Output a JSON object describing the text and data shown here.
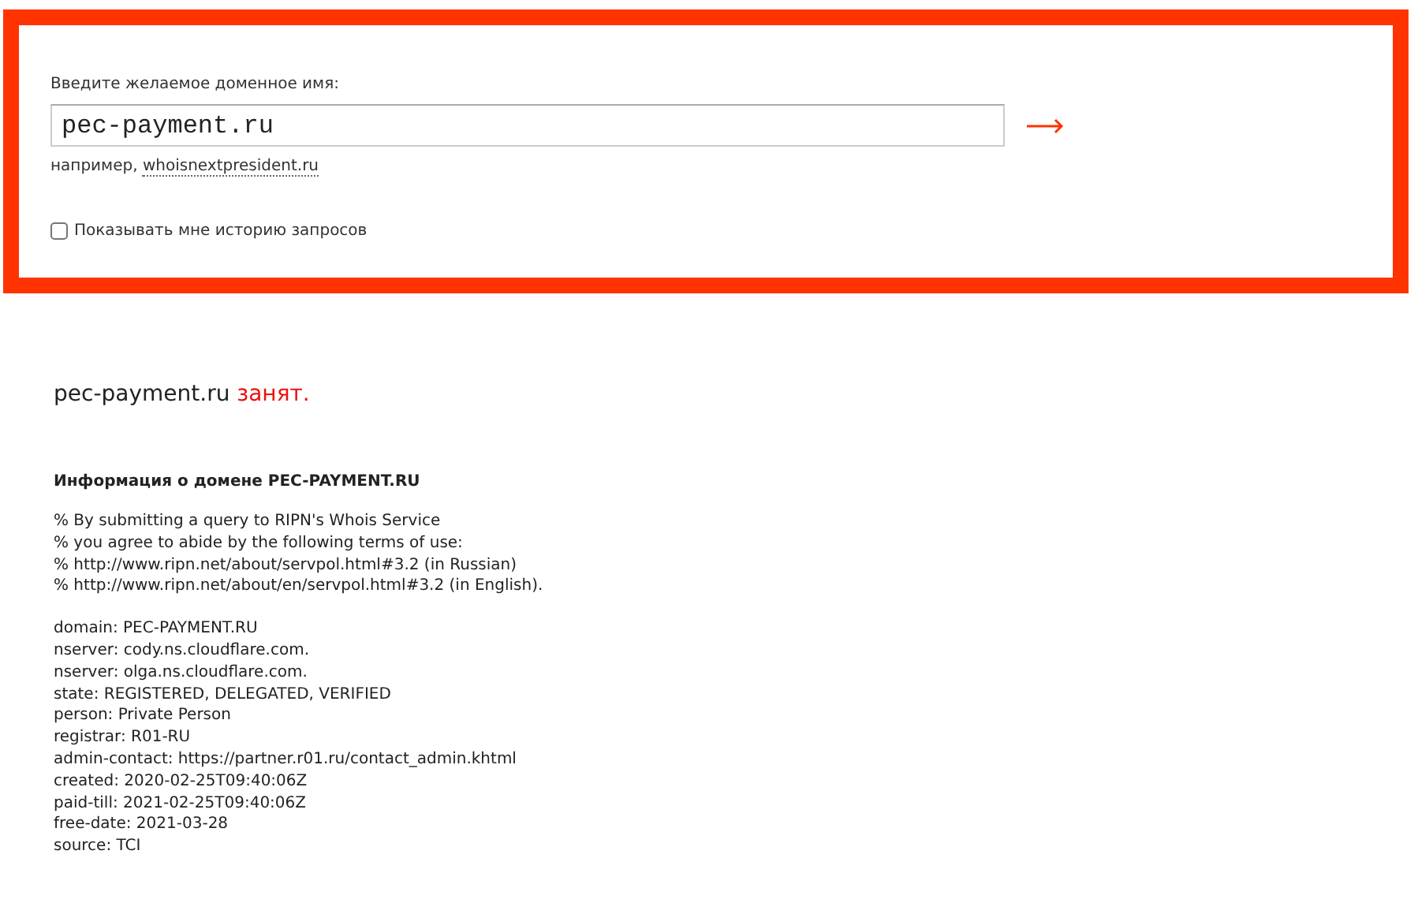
{
  "search": {
    "label": "Введите желаемое доменное имя:",
    "value": "pec-payment.ru",
    "example_prefix": "например,",
    "example_link": "whoisnextpresident.ru",
    "history": {
      "label": "Показывать мне историю запросов",
      "checked": false
    }
  },
  "result": {
    "domain": "pec-payment.ru",
    "status": "занят.",
    "taken": true
  },
  "info": {
    "title": "Информация о домене PEC-PAYMENT.RU",
    "notice": [
      "% By submitting a query to RIPN's Whois Service",
      "% you agree to abide by the following terms of use:",
      "% http://www.ripn.net/about/servpol.html#3.2 (in Russian)",
      "% http://www.ripn.net/about/en/servpol.html#3.2 (in English)."
    ],
    "records": [
      "domain: PEC-PAYMENT.RU",
      "nserver: cody.ns.cloudflare.com.",
      "nserver: olga.ns.cloudflare.com.",
      "state: REGISTERED, DELEGATED, VERIFIED",
      "person: Private Person",
      "registrar: R01-RU",
      "admin-contact: https://partner.r01.ru/contact_admin.khtml",
      "created: 2020-02-25T09:40:06Z",
      "paid-till: 2021-02-25T09:40:06Z",
      "free-date: 2021-03-28",
      "source: TCI"
    ]
  }
}
